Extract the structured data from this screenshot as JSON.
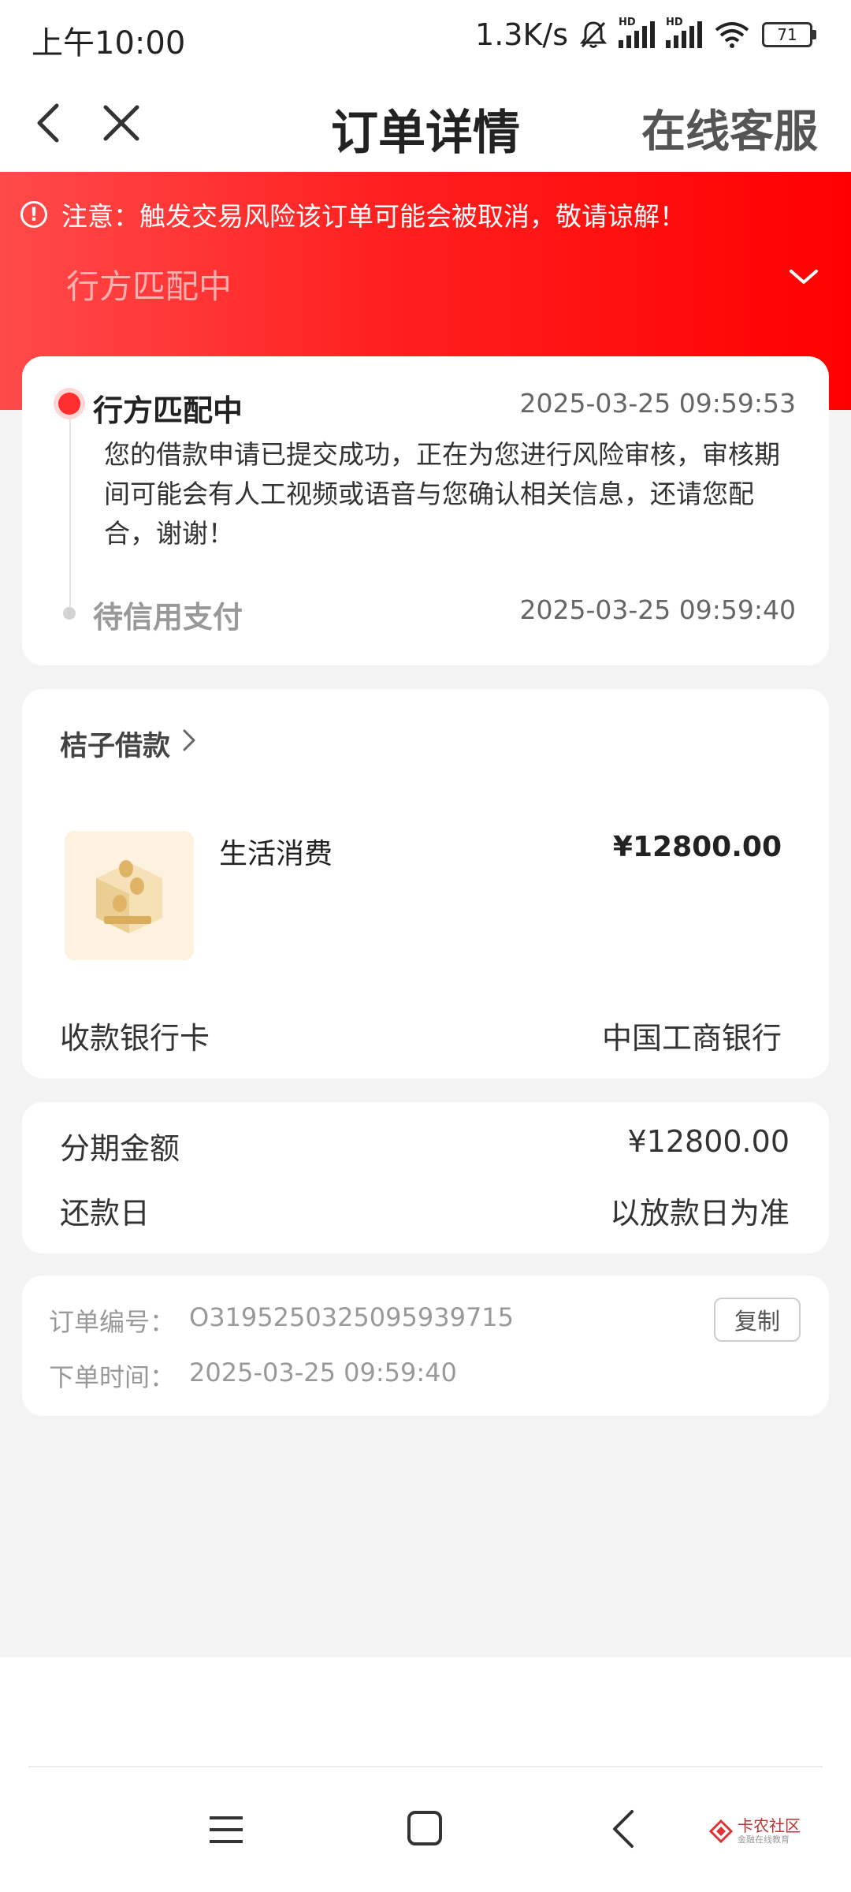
{
  "status_bar": {
    "time": "上午10:00",
    "net_speed": "1.3K/s",
    "hd_badge_1": "HD",
    "hd_badge_2": "HD",
    "battery": "71",
    "icons": [
      "bell-muted-icon",
      "signal-icon",
      "signal-icon",
      "wifi-icon",
      "battery-icon"
    ]
  },
  "nav": {
    "title": "订单详情",
    "service": "在线客服",
    "icons": [
      "back-icon",
      "close-icon"
    ]
  },
  "banner": {
    "notice": "注意：触发交易风险该订单可能会被取消，敬请谅解！",
    "status": "行方匹配中",
    "colors": {
      "start": "#ff4a4a",
      "end": "#ff0000"
    }
  },
  "timeline": {
    "items": [
      {
        "title": "行方匹配中",
        "time": "2025-03-25 09:59:53",
        "desc": "您的借款申请已提交成功，正在为您进行风险审核，审核期间可能会有人工视频或语音与您确认相关信息，还请您配合，谢谢！"
      },
      {
        "title": "待信用支付",
        "time": "2025-03-25 09:59:40"
      }
    ]
  },
  "product": {
    "merchant": "桔子借款",
    "usage": "生活消费",
    "amount": "¥12800.00",
    "bank_label": "收款银行卡",
    "bank_value": "中国工商银行"
  },
  "installment": {
    "amount_label": "分期金额",
    "amount_value": "¥12800.00",
    "repay_label": "还款日",
    "repay_value": "以放款日为准"
  },
  "order_info": {
    "order_no_label": "订单编号：",
    "order_no": "O319525032509593971​5",
    "order_time_label": "下单时间：",
    "order_time": "2025-03-25 09:59:40",
    "copy": "复制"
  },
  "watermark": {
    "title": "卡农社区",
    "subtitle": "金融在线教育"
  },
  "accent_color": "#ff2d2d"
}
